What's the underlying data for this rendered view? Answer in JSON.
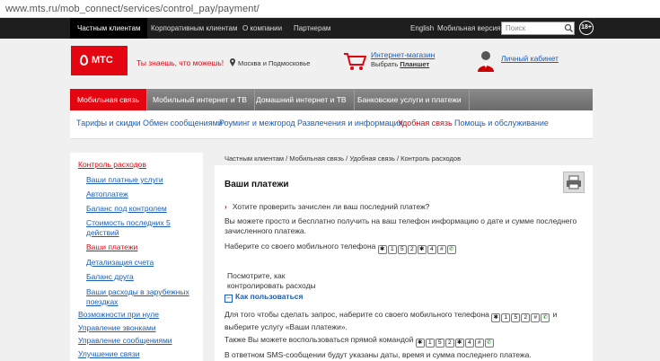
{
  "browser": {
    "url": "www.mts.ru/mob_connect/services/control_pay/payment/"
  },
  "topnav": {
    "items": [
      "Частным клиентам",
      "Корпоративным клиентам",
      "О компании",
      "Партнерам"
    ],
    "english": "English",
    "mobile_version": "Мобильная версия",
    "search_placeholder": "Поиск",
    "age": "18+"
  },
  "header": {
    "logo_text": "МТС",
    "slogan": "Ты знаешь, что можешь!",
    "region": "Москва и Подмосковье",
    "shop_title": "Интернет-магазин",
    "shop_sub_prefix": "Выбрать",
    "shop_sub_link": "Планшет",
    "cabinet": "Личный кабинет"
  },
  "mainnav": [
    "Мобильная связь",
    "Мобильный интернет и ТВ",
    "Домашний интернет и ТВ",
    "Банковские услуги и платежи"
  ],
  "subnav": [
    "Тарифы и скидки",
    "Обмен сообщениями",
    "Роуминг и межгород",
    "Развлечения и информация",
    "Удобная связь",
    "Помощь и обслуживание"
  ],
  "sidebar": [
    "Контроль расходов",
    "Ваши платные услуги",
    "Автоплатеж",
    "Баланс под контролем",
    "Стоимость последних 5 действий",
    "Ваши платежи",
    "Детализация счета",
    "Баланс друга",
    "Ваши расходы в зарубежных поездках",
    "Возможности при нуле",
    "Управление звонками",
    "Управление сообщениями",
    "Улучшение связи"
  ],
  "breadcrumbs": "Частным клиентам / Мобильная связь / Удобная связь / Контроль расходов",
  "content": {
    "title": "Ваши платежи",
    "question": "Хотите проверить зачислен ли ваш последний платеж?",
    "intro": "Вы можете просто и бесплатно получить на ваш телефон информацию о дате и сумме последнего зачисленного платежа.",
    "dial_prefix": "Наберите со своего мобильного телефона",
    "code1": [
      "✱",
      "1",
      "5",
      "2",
      "✱",
      "4",
      "#",
      "✆"
    ],
    "see_how": "Посмотрите, как контролировать расходы",
    "how_to_use": "Как пользоваться",
    "request_text_1": "Для того чтобы сделать запрос, наберите со своего мобильного телефона",
    "code2": [
      "✱",
      "1",
      "5",
      "2",
      "#",
      "✆"
    ],
    "request_text_2": "и",
    "request_text_3": "выберите услугу «Ваши платежи».",
    "also_text": "Также Вы можете воспользоваться прямой командой",
    "code3": [
      "✱",
      "1",
      "5",
      "2",
      "✱",
      "4",
      "#",
      "✆"
    ],
    "sms_text": "В ответном SMS-сообщении будут указаны даты, время и сумма последнего платежа."
  }
}
